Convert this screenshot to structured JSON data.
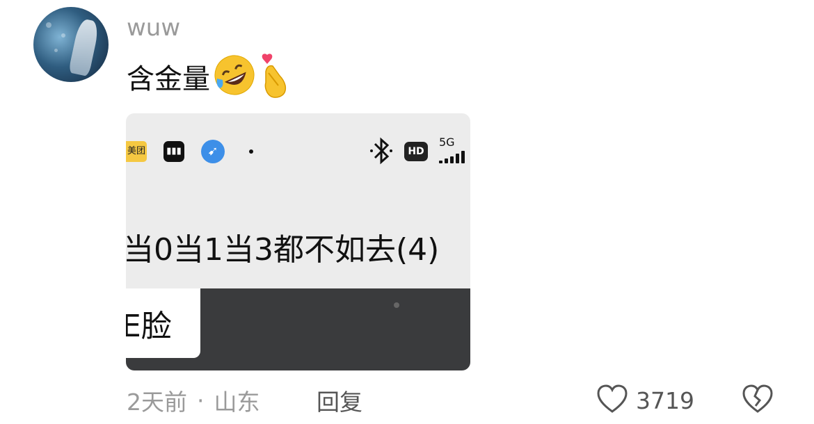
{
  "comment": {
    "username": "wuw",
    "text": "含金量",
    "emojis": [
      "rolling-on-floor-laughing-emoji",
      "finger-heart-emoji"
    ]
  },
  "attached_screenshot": {
    "statusbar": {
      "app_icons": [
        "meituan-icon",
        "music-icon",
        "bird-app-icon"
      ],
      "meituan_label": "美团",
      "network": "5G",
      "hd_badge": "HD"
    },
    "headline": "当0当1当3都不如去(4)",
    "card_text": "E脸"
  },
  "footer": {
    "time": "2天前",
    "separator": "·",
    "location": "山东",
    "reply_label": "回复",
    "like_count": "3719"
  }
}
